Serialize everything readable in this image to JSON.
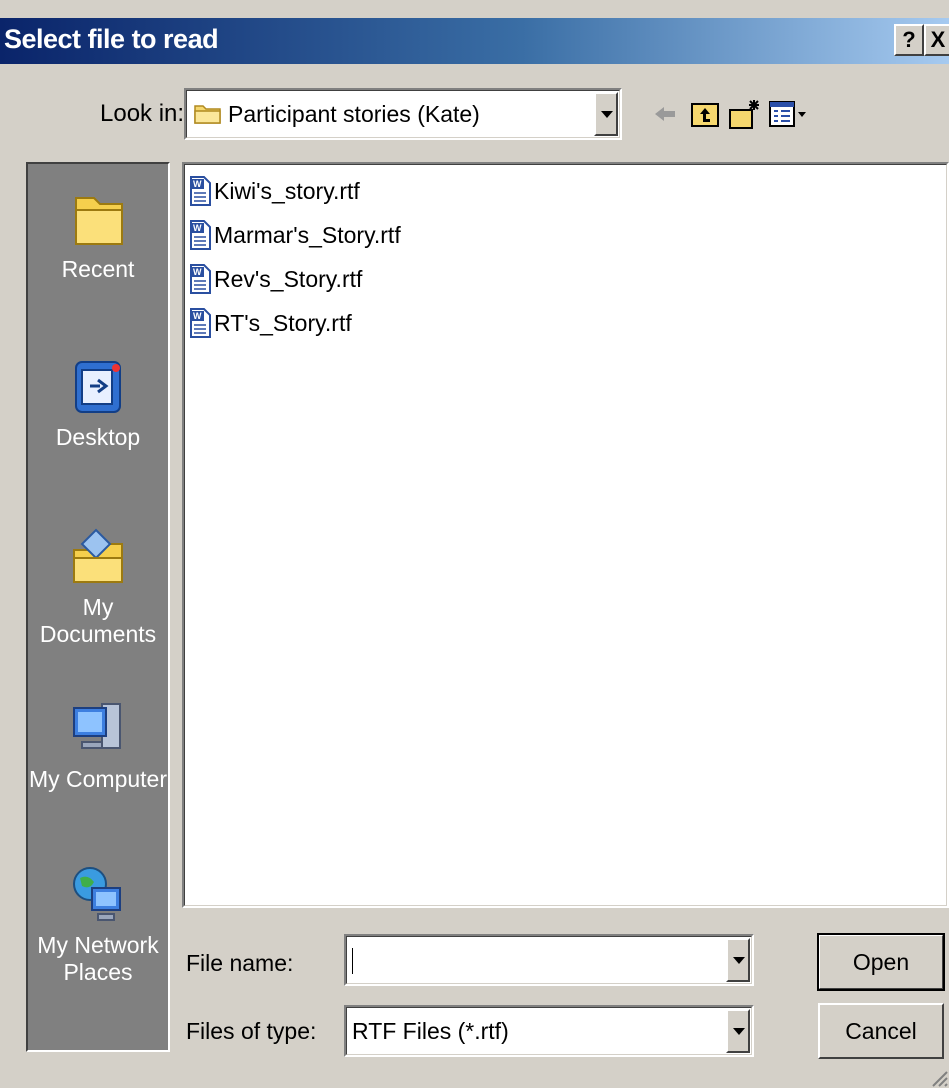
{
  "window": {
    "title": "Select file to read",
    "help": "?",
    "close": "X"
  },
  "lookin": {
    "label": "Look in:",
    "value": "Participant stories (Kate)"
  },
  "toolbar": {
    "back": "back-arrow-icon",
    "up": "up-folder-icon",
    "new_folder": "new-folder-icon",
    "views": "views-menu-icon"
  },
  "places": [
    {
      "label": "Recent",
      "icon": "recent-folder-icon"
    },
    {
      "label": "Desktop",
      "icon": "desktop-icon"
    },
    {
      "label": "My Documents",
      "icon": "my-documents-icon"
    },
    {
      "label": "My Computer",
      "icon": "my-computer-icon"
    },
    {
      "label": "My Network Places",
      "icon": "network-places-icon"
    }
  ],
  "files": [
    {
      "name": "Kiwi's_story.rtf",
      "icon": "word-document-icon"
    },
    {
      "name": "Marmar's_Story.rtf",
      "icon": "word-document-icon"
    },
    {
      "name": "Rev's_Story.rtf",
      "icon": "word-document-icon"
    },
    {
      "name": "RT's_Story.rtf",
      "icon": "word-document-icon"
    }
  ],
  "filename": {
    "label": "File name:",
    "value": ""
  },
  "filetype": {
    "label": "Files of type:",
    "value": "RTF Files (*.rtf)"
  },
  "buttons": {
    "open": "Open",
    "cancel": "Cancel"
  },
  "colors": {
    "title_start": "#0a246a",
    "title_end": "#a6caf0",
    "face": "#d4d0c8",
    "places_bg": "#808080"
  }
}
